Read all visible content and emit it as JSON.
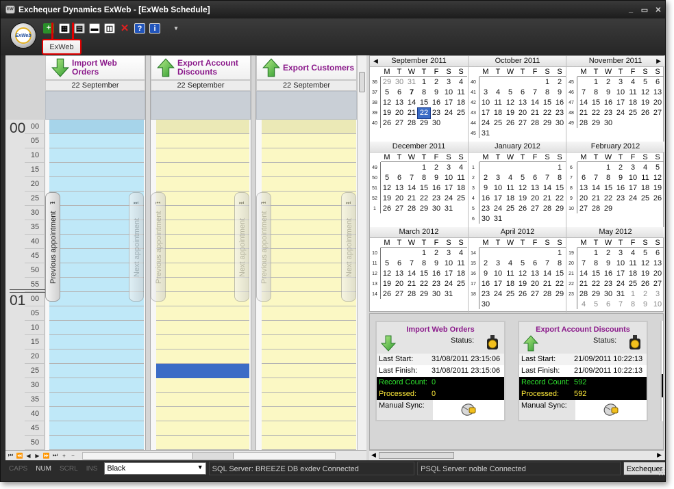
{
  "window": {
    "title": "Exchequer Dynamics ExWeb - [ExWeb Schedule]",
    "icon_text": "EW",
    "controls": [
      "_",
      "▭",
      "✕"
    ]
  },
  "ribbon": {
    "orb_text": "ExWeb",
    "active_tab": "ExWeb",
    "qat_more": "▾"
  },
  "scheduler": {
    "hours": [
      "00",
      "01"
    ],
    "minutes": [
      "00",
      "05",
      "10",
      "15",
      "20",
      "25",
      "30",
      "35",
      "40",
      "45",
      "50",
      "55",
      "00",
      "05",
      "10",
      "15",
      "20",
      "25",
      "30",
      "35",
      "40",
      "45",
      "50"
    ],
    "resources": [
      {
        "name": "Import Web Orders",
        "date": "22 September",
        "arrow": "down",
        "color": "#bfe8f8"
      },
      {
        "name": "Export Account Discounts",
        "date": "22 September",
        "arrow": "up",
        "color": "#fbf8c4"
      },
      {
        "name": "Export Customers",
        "date": "22 September",
        "arrow": "up",
        "color": "#fbf8c4"
      }
    ],
    "prev_label": "Previous appointment",
    "next_label": "Next appointment",
    "nav_buttons": [
      "⏮",
      "⏪",
      "◀",
      "▶",
      "⏩",
      "⏭",
      "+",
      "−"
    ]
  },
  "calendar": {
    "dow": [
      "M",
      "T",
      "W",
      "T",
      "F",
      "S",
      "S"
    ],
    "months": [
      {
        "name": "September 2011",
        "weeks": [
          "36",
          "37",
          "38",
          "39",
          "40"
        ],
        "days": [
          [
            "29",
            "30",
            "31",
            "1",
            "2",
            "3",
            "4"
          ],
          [
            "5",
            "6",
            "7",
            "8",
            "9",
            "10",
            "11"
          ],
          [
            "12",
            "13",
            "14",
            "15",
            "16",
            "17",
            "18"
          ],
          [
            "19",
            "20",
            "21",
            "22",
            "23",
            "24",
            "25"
          ],
          [
            "26",
            "27",
            "28",
            "29",
            "30",
            "",
            ""
          ]
        ],
        "other": [
          [
            0,
            0
          ],
          [
            0,
            1
          ],
          [
            0,
            2
          ]
        ],
        "bold": [
          [
            1,
            2
          ]
        ],
        "selected": [
          [
            3,
            3
          ]
        ]
      },
      {
        "name": "October 2011",
        "weeks": [
          "40",
          "41",
          "42",
          "43",
          "44",
          "45"
        ],
        "days": [
          [
            "",
            "",
            "",
            "",
            "",
            "1",
            "2"
          ],
          [
            "3",
            "4",
            "5",
            "6",
            "7",
            "8",
            "9"
          ],
          [
            "10",
            "11",
            "12",
            "13",
            "14",
            "15",
            "16"
          ],
          [
            "17",
            "18",
            "19",
            "20",
            "21",
            "22",
            "23"
          ],
          [
            "24",
            "25",
            "26",
            "27",
            "28",
            "29",
            "30"
          ],
          [
            "31",
            "",
            "",
            "",
            "",
            "",
            ""
          ]
        ],
        "other": [],
        "bold": [],
        "selected": []
      },
      {
        "name": "November 2011",
        "weeks": [
          "45",
          "46",
          "47",
          "48",
          "49"
        ],
        "days": [
          [
            "",
            "1",
            "2",
            "3",
            "4",
            "5",
            "6"
          ],
          [
            "7",
            "8",
            "9",
            "10",
            "11",
            "12",
            "13"
          ],
          [
            "14",
            "15",
            "16",
            "17",
            "18",
            "19",
            "20"
          ],
          [
            "21",
            "22",
            "23",
            "24",
            "25",
            "26",
            "27"
          ],
          [
            "28",
            "29",
            "30",
            "",
            "",
            "",
            ""
          ]
        ],
        "other": [],
        "bold": [],
        "selected": []
      },
      {
        "name": "December 2011",
        "weeks": [
          "49",
          "50",
          "51",
          "52",
          "1"
        ],
        "days": [
          [
            "",
            "",
            "",
            "1",
            "2",
            "3",
            "4"
          ],
          [
            "5",
            "6",
            "7",
            "8",
            "9",
            "10",
            "11"
          ],
          [
            "12",
            "13",
            "14",
            "15",
            "16",
            "17",
            "18"
          ],
          [
            "19",
            "20",
            "21",
            "22",
            "23",
            "24",
            "25"
          ],
          [
            "26",
            "27",
            "28",
            "29",
            "30",
            "31",
            ""
          ]
        ],
        "other": [],
        "bold": [],
        "selected": []
      },
      {
        "name": "January 2012",
        "weeks": [
          "1",
          "2",
          "3",
          "4",
          "5",
          "6"
        ],
        "days": [
          [
            "",
            "",
            "",
            "",
            "",
            "",
            "1"
          ],
          [
            "2",
            "3",
            "4",
            "5",
            "6",
            "7",
            "8"
          ],
          [
            "9",
            "10",
            "11",
            "12",
            "13",
            "14",
            "15"
          ],
          [
            "16",
            "17",
            "18",
            "19",
            "20",
            "21",
            "22"
          ],
          [
            "23",
            "24",
            "25",
            "26",
            "27",
            "28",
            "29"
          ],
          [
            "30",
            "31",
            "",
            "",
            "",
            "",
            ""
          ]
        ],
        "other": [],
        "bold": [],
        "selected": []
      },
      {
        "name": "February 2012",
        "weeks": [
          "6",
          "7",
          "8",
          "9",
          "10"
        ],
        "days": [
          [
            "",
            "",
            "1",
            "2",
            "3",
            "4",
            "5"
          ],
          [
            "6",
            "7",
            "8",
            "9",
            "10",
            "11",
            "12"
          ],
          [
            "13",
            "14",
            "15",
            "16",
            "17",
            "18",
            "19"
          ],
          [
            "20",
            "21",
            "22",
            "23",
            "24",
            "25",
            "26"
          ],
          [
            "27",
            "28",
            "29",
            "",
            "",
            "",
            ""
          ]
        ],
        "other": [],
        "bold": [],
        "selected": []
      },
      {
        "name": "March 2012",
        "weeks": [
          "10",
          "11",
          "12",
          "13",
          "14"
        ],
        "days": [
          [
            "",
            "",
            "",
            "1",
            "2",
            "3",
            "4"
          ],
          [
            "5",
            "6",
            "7",
            "8",
            "9",
            "10",
            "11"
          ],
          [
            "12",
            "13",
            "14",
            "15",
            "16",
            "17",
            "18"
          ],
          [
            "19",
            "20",
            "21",
            "22",
            "23",
            "24",
            "25"
          ],
          [
            "26",
            "27",
            "28",
            "29",
            "30",
            "31",
            ""
          ]
        ],
        "other": [],
        "bold": [],
        "selected": []
      },
      {
        "name": "April 2012",
        "weeks": [
          "14",
          "15",
          "16",
          "17",
          "18"
        ],
        "days": [
          [
            "",
            "",
            "",
            "",
            "",
            "",
            "1"
          ],
          [
            "2",
            "3",
            "4",
            "5",
            "6",
            "7",
            "8"
          ],
          [
            "9",
            "10",
            "11",
            "12",
            "13",
            "14",
            "15"
          ],
          [
            "16",
            "17",
            "18",
            "19",
            "20",
            "21",
            "22"
          ],
          [
            "23",
            "24",
            "25",
            "26",
            "27",
            "28",
            "29"
          ],
          [
            "30",
            "",
            "",
            "",
            "",
            "",
            ""
          ]
        ],
        "other": [],
        "bold": [],
        "selected": []
      },
      {
        "name": "May 2012",
        "weeks": [
          "19",
          "20",
          "21",
          "22",
          "23"
        ],
        "days": [
          [
            "",
            "1",
            "2",
            "3",
            "4",
            "5",
            "6"
          ],
          [
            "7",
            "8",
            "9",
            "10",
            "11",
            "12",
            "13"
          ],
          [
            "14",
            "15",
            "16",
            "17",
            "18",
            "19",
            "20"
          ],
          [
            "21",
            "22",
            "23",
            "24",
            "25",
            "26",
            "27"
          ],
          [
            "28",
            "29",
            "30",
            "31",
            "1",
            "2",
            "3"
          ],
          [
            "4",
            "5",
            "6",
            "7",
            "8",
            "9",
            "10"
          ]
        ],
        "other": [
          [
            4,
            4
          ],
          [
            4,
            5
          ],
          [
            4,
            6
          ],
          [
            5,
            0
          ],
          [
            5,
            1
          ],
          [
            5,
            2
          ],
          [
            5,
            3
          ],
          [
            5,
            4
          ],
          [
            5,
            5
          ],
          [
            5,
            6
          ]
        ],
        "bold": [],
        "selected": []
      }
    ]
  },
  "status_cards": [
    {
      "title": "Import Web Orders",
      "arrow": "down",
      "status_label": "Status:",
      "last_start_label": "Last Start:",
      "last_start": "31/08/2011 23:15:06",
      "last_finish_label": "Last Finish:",
      "last_finish": "31/08/2011 23:15:06",
      "record_count_label": "Record Count:",
      "record_count": "0",
      "processed_label": "Processed:",
      "processed": "0",
      "manual_sync_label": "Manual Sync:"
    },
    {
      "title": "Export Account Discounts",
      "arrow": "up",
      "status_label": "Status:",
      "last_start_label": "Last Start:",
      "last_start": "21/09/2011 10:22:13",
      "last_finish_label": "Last Finish:",
      "last_finish": "21/09/2011 10:22:13",
      "record_count_label": "Record Count:",
      "record_count": "592",
      "processed_label": "Processed:",
      "processed": "592",
      "manual_sync_label": "Manual Sync:"
    }
  ],
  "statusbar": {
    "indicators": [
      {
        "label": "CAPS",
        "on": false
      },
      {
        "label": "NUM",
        "on": true
      },
      {
        "label": "SCRL",
        "on": false
      },
      {
        "label": "INS",
        "on": false
      }
    ],
    "theme": "Black",
    "sql": "SQL Server: BREEZE DB exdev Connected",
    "psql": "PSQL Server: noble Connected",
    "exch": "Exchequer"
  },
  "colors": {
    "resource_name": "#8b1a8b",
    "selected_day": "#3b6cc6",
    "appointment": "#3b6cc6",
    "record_count_text": "#2fe42f",
    "processed_text": "#ffeb3b"
  }
}
